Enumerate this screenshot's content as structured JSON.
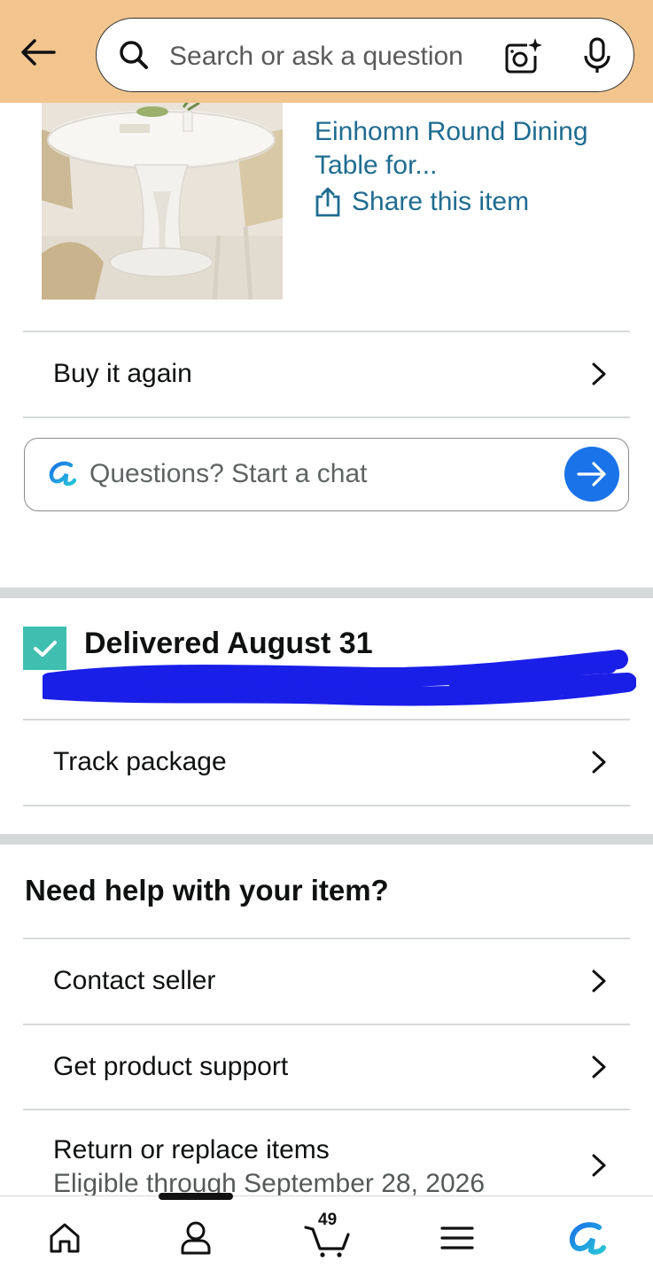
{
  "header": {
    "search_placeholder": "Search or ask a question"
  },
  "product": {
    "title": "Einhomn Round Dining Table for...",
    "share_label": "Share this item"
  },
  "actions": {
    "buy_again": "Buy it again",
    "chat_placeholder": "Questions? Start a chat"
  },
  "delivery": {
    "status": "Delivered August 31",
    "check_color": "#3fbfb0",
    "track_label": "Track package"
  },
  "help": {
    "title": "Need help with your item?",
    "contact_seller": "Contact seller",
    "product_support": "Get product support",
    "return_title": "Return or replace items",
    "return_subtitle": "Eligible through September 28, 2026"
  },
  "bottom_nav": {
    "cart_count": "49",
    "items": [
      "home-icon",
      "account-icon",
      "cart-icon",
      "menu-icon",
      "rufus-icon"
    ]
  },
  "colors": {
    "header_bg": "#f2c58f",
    "link": "#1f6c91",
    "accent_blue": "#1a73e8"
  }
}
